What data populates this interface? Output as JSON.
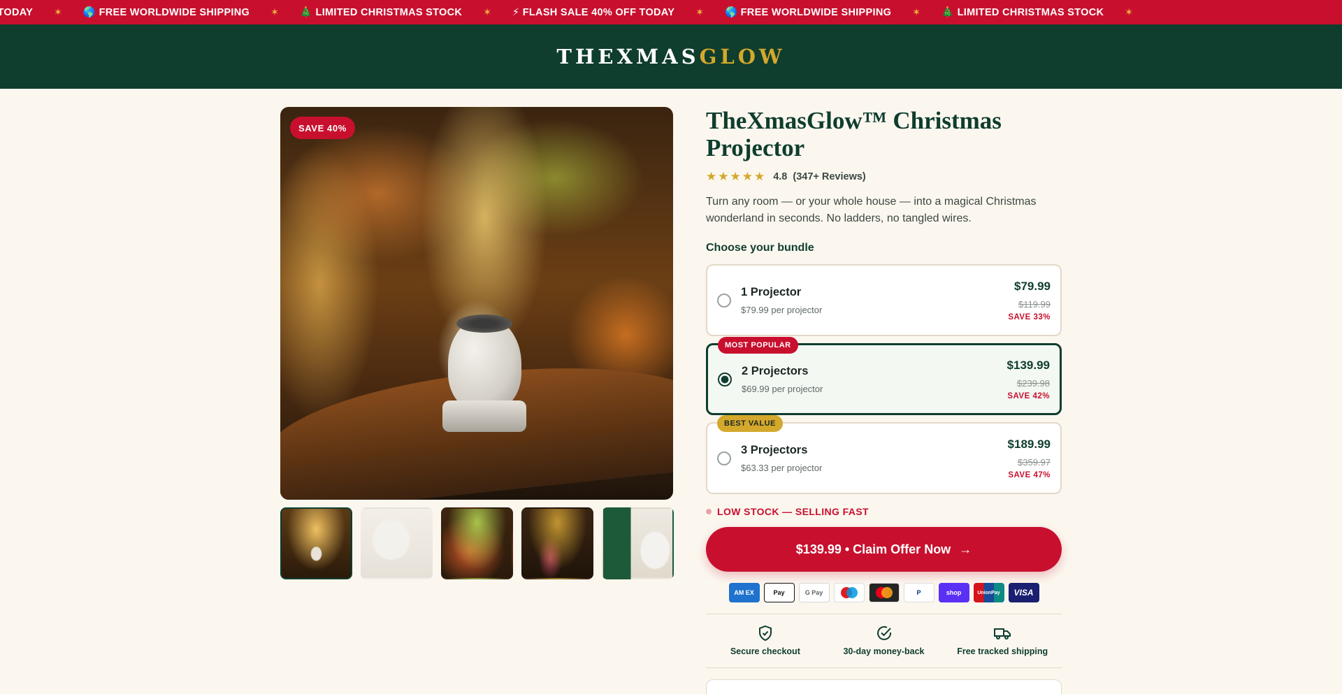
{
  "ticker": {
    "items": [
      "F TODAY",
      "🌎 FREE WORLDWIDE SHIPPING",
      "🎄 LIMITED CHRISTMAS STOCK",
      "⚡ FLASH SALE 40% OFF TODAY",
      "🌎 FREE WORLDWIDE SHIPPING",
      "🎄 LIMITED CHRISTMAS STOCK"
    ],
    "separator": "✶"
  },
  "logo": {
    "part1": "THEXMAS",
    "part2": "GLOW"
  },
  "gallery": {
    "badge": "SAVE 40%",
    "thumbnails": [
      "thumb-1",
      "thumb-2",
      "thumb-3",
      "thumb-4",
      "thumb-5"
    ]
  },
  "product": {
    "title": "TheXmasGlow™ Christmas Projector",
    "stars": "★★★★★",
    "rating": "4.8",
    "reviews": "(347+ Reviews)",
    "description": "Turn any room — or your whole house — into a magical Christmas wonderland in seconds. No ladders, no tangled wires."
  },
  "bundles": {
    "label": "Choose your bundle",
    "options": [
      {
        "name": "1 Projector",
        "per": "$79.99 per projector",
        "price": "$79.99",
        "old": "$119.99",
        "save": "SAVE 33%",
        "tag": ""
      },
      {
        "name": "2 Projectors",
        "per": "$69.99 per projector",
        "price": "$139.99",
        "old": "$239.98",
        "save": "SAVE 42%",
        "tag": "MOST POPULAR"
      },
      {
        "name": "3 Projectors",
        "per": "$63.33 per projector",
        "price": "$189.99",
        "old": "$359.97",
        "save": "SAVE 47%",
        "tag": "BEST VALUE"
      }
    ],
    "selected_index": 1
  },
  "stock": "LOW STOCK — SELLING FAST",
  "cta": {
    "label": "$139.99 • Claim Offer Now",
    "arrow": "→"
  },
  "payments": [
    "AM EX",
    "Pay",
    "G Pay",
    "maestro",
    "mastercard",
    "P",
    "shop",
    "UnionPay",
    "VISA"
  ],
  "features": [
    {
      "icon": "shield-check-icon",
      "label": "Secure checkout"
    },
    {
      "icon": "check-circle-icon",
      "label": "30-day money-back"
    },
    {
      "icon": "truck-icon",
      "label": "Free tracked shipping"
    }
  ],
  "colors": {
    "accent_red": "#c8102e",
    "brand_green": "#0f3d2e",
    "gold": "#d4a82b",
    "background": "#fbf7ef"
  }
}
